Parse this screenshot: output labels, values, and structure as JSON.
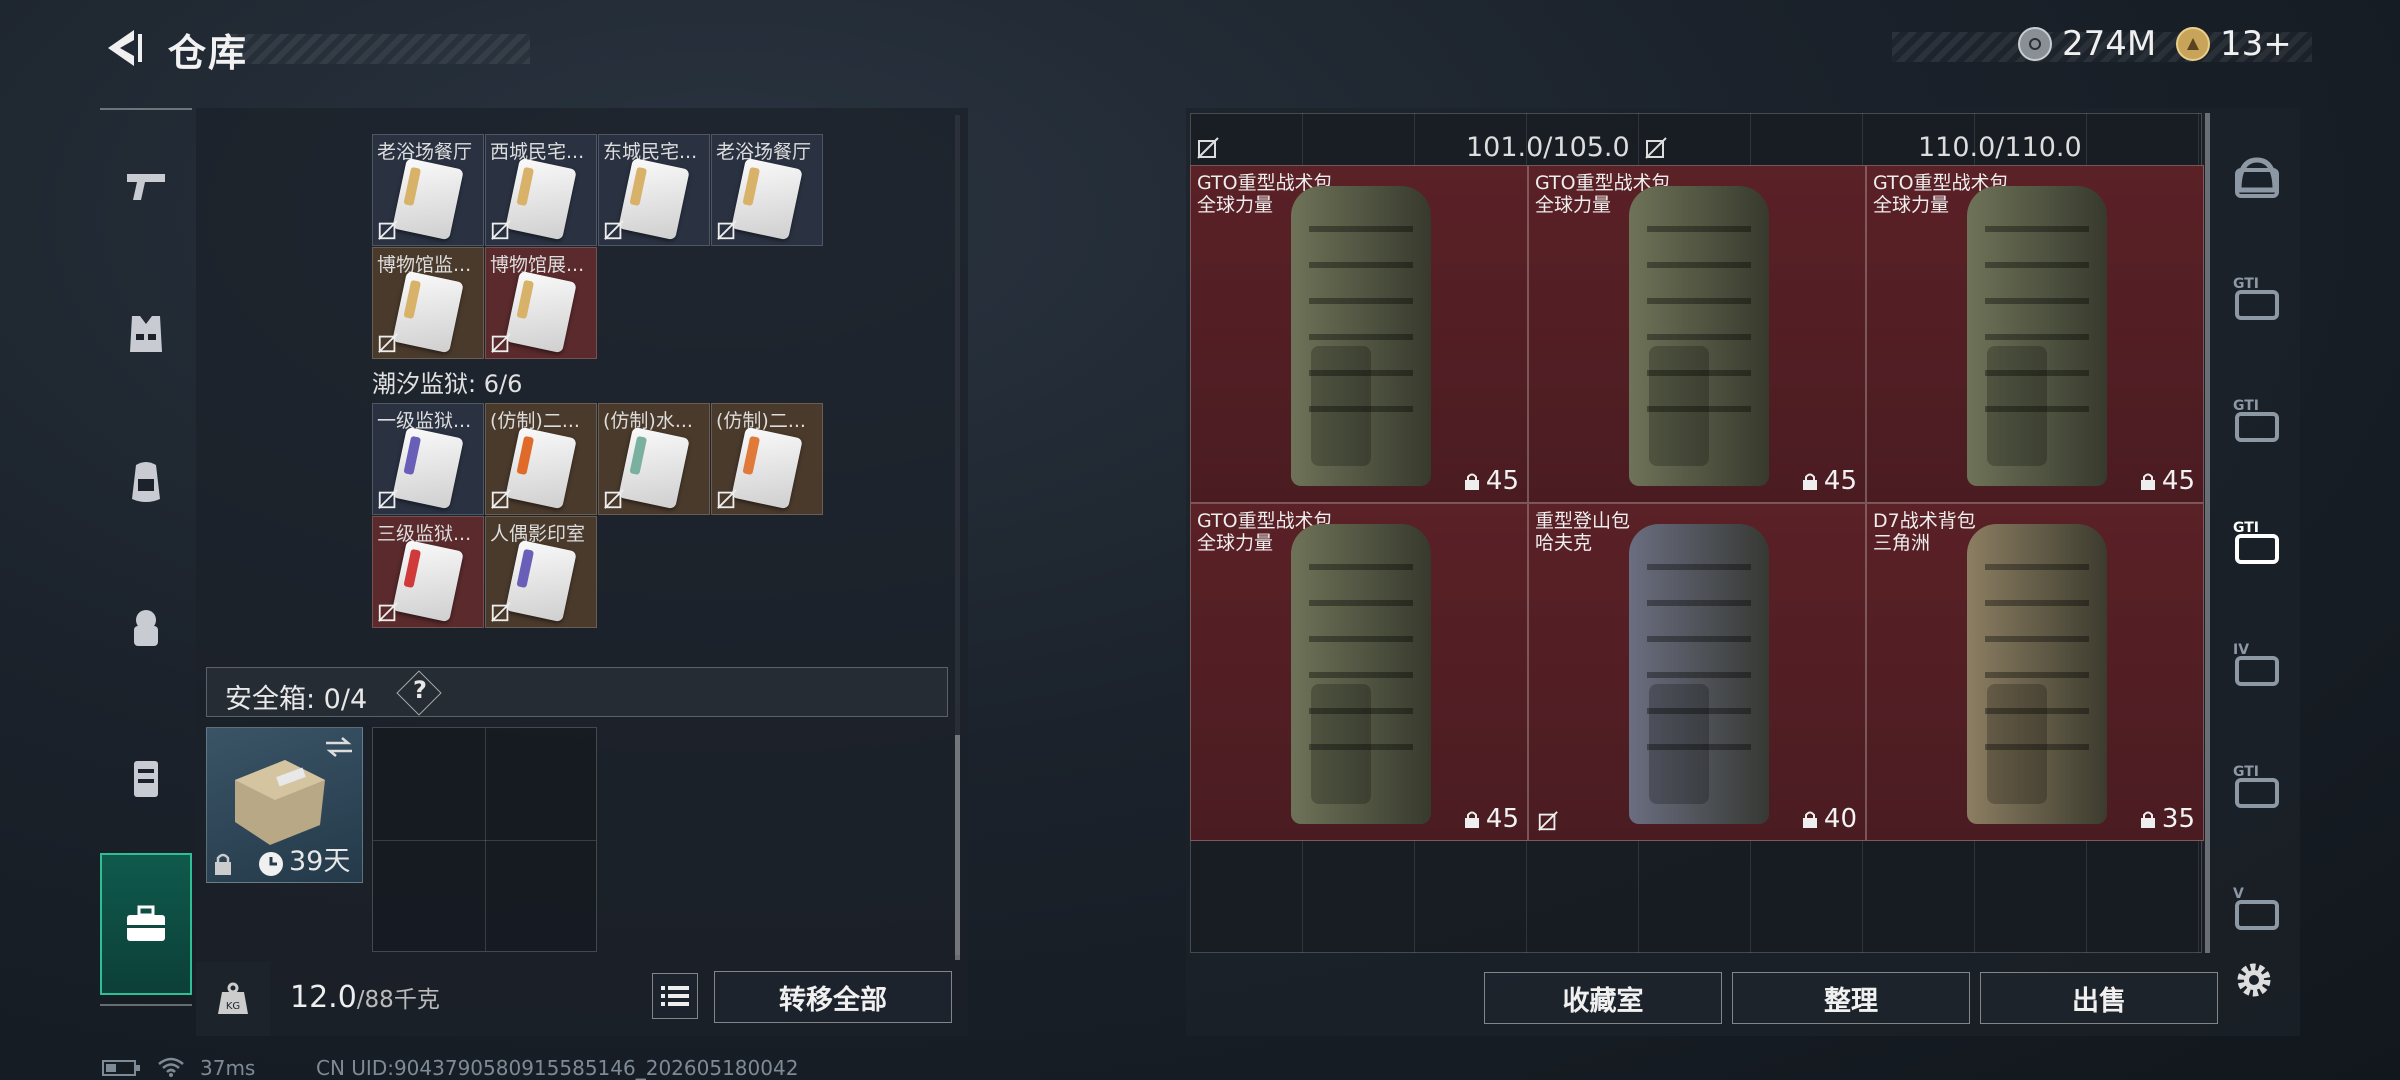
{
  "header": {
    "title": "仓库",
    "currency": {
      "value": "274M"
    },
    "tickets": {
      "value": "13+"
    }
  },
  "left_sidebar": {
    "items": [
      {
        "icon": "pistol-icon"
      },
      {
        "icon": "vest-icon"
      },
      {
        "icon": "backpack-icon"
      },
      {
        "icon": "helmet-backpack-icon"
      },
      {
        "icon": "chest-rig-icon"
      },
      {
        "icon": "toolbox-icon",
        "active": true
      }
    ]
  },
  "keys_section": {
    "rows_top": [
      {
        "name": "老浴场餐厅",
        "color": "blue",
        "stripe": "#d9b26a"
      },
      {
        "name": "西城民宅...",
        "color": "blue",
        "stripe": "#d9b26a"
      },
      {
        "name": "东城民宅...",
        "color": "blue",
        "stripe": "#d9b26a"
      },
      {
        "name": "老浴场餐厅",
        "color": "blue",
        "stripe": "#d9b26a"
      },
      {
        "name": "博物馆监...",
        "color": "brown",
        "stripe": "#d9b26a"
      },
      {
        "name": "博物馆展...",
        "color": "red",
        "stripe": "#d9b26a"
      }
    ],
    "prison_label": "潮汐监狱: 6/6",
    "rows_prison": [
      {
        "name": "一级监狱...",
        "color": "blue",
        "stripe": "#6a5fb8"
      },
      {
        "name": "(仿制)二...",
        "color": "brown",
        "stripe": "#e06a2a"
      },
      {
        "name": "(仿制)水...",
        "color": "brown",
        "stripe": "#7ab0a0"
      },
      {
        "name": "(仿制)二...",
        "color": "brown",
        "stripe": "#e07a3a"
      },
      {
        "name": "三级监狱...",
        "color": "red",
        "stripe": "#d03a3a"
      },
      {
        "name": "人偶影印室",
        "color": "brown",
        "stripe": "#6a5fb8"
      }
    ]
  },
  "safebox": {
    "label": "安全箱: 0/4",
    "help": "?",
    "timer": "39天"
  },
  "bottom_left": {
    "weight": "12.0",
    "weight_max": "/88千克",
    "transfer_all": "转移全部"
  },
  "backpack_panel": {
    "capacity_left": "101.0/105.0",
    "capacity_right": "110.0/110.0",
    "bags": [
      {
        "name": "GTO重型战术包",
        "brand": "全球力量",
        "level": "45",
        "color": "#6e7358",
        "marked": false
      },
      {
        "name": "GTO重型战术包",
        "brand": "全球力量",
        "level": "45",
        "color": "#6e7358",
        "marked": false
      },
      {
        "name": "GTO重型战术包",
        "brand": "全球力量",
        "level": "45",
        "color": "#6e7358",
        "marked": false
      },
      {
        "name": "GTO重型战术包",
        "brand": "全球力量",
        "level": "45",
        "color": "#6e7358",
        "marked": false
      },
      {
        "name": "重型登山包",
        "brand": "哈夫克",
        "level": "40",
        "color": "#6a6e80",
        "marked": true
      },
      {
        "name": "D7战术背包",
        "brand": "三角洲",
        "level": "35",
        "color": "#8c7e62",
        "marked": false
      }
    ],
    "buttons": {
      "collection": "收藏室",
      "organize": "整理",
      "sell": "出售"
    }
  },
  "right_sidebar": {
    "items": [
      {
        "label": "",
        "icon": "helmet-icon"
      },
      {
        "label": "GTI",
        "icon": "vehicle-icon"
      },
      {
        "label": "GTI",
        "icon": "vehicle-key-icon"
      },
      {
        "label": "GTI",
        "icon": "warning-crate-icon",
        "active": true
      },
      {
        "label": "IV",
        "icon": "medkit-icon"
      },
      {
        "label": "GTI",
        "icon": "weapon-crate-icon"
      },
      {
        "label": "V",
        "icon": "tool-crate-icon"
      }
    ]
  },
  "status_bar": {
    "ping": "37ms",
    "uid": "CN UID:9043790580915585146_202605180042"
  }
}
